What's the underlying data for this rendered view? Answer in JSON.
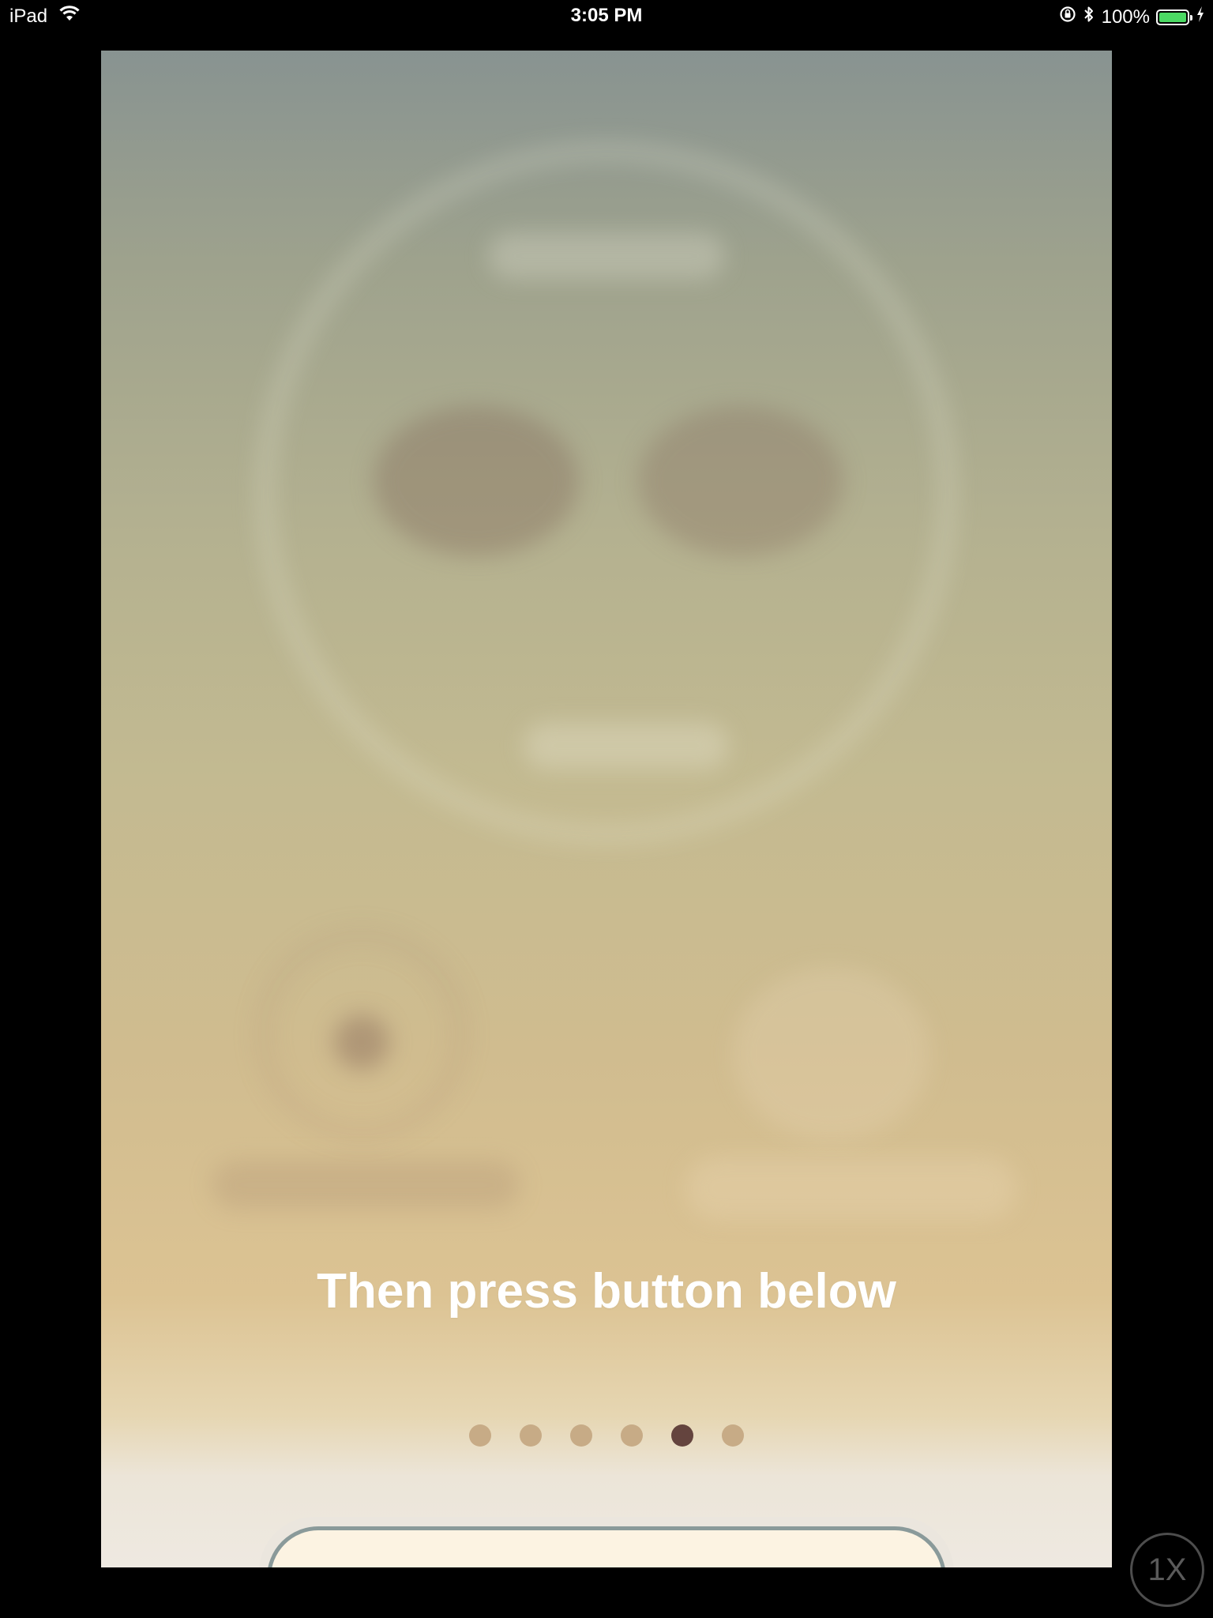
{
  "status_bar": {
    "device": "iPad",
    "time": "3:05 PM",
    "battery_percent": "100%",
    "battery_level": 1.0,
    "battery_color": "#4cd964",
    "icons": [
      "wifi-icon",
      "orientation-lock-icon",
      "bluetooth-icon",
      "battery-icon",
      "charging-bolt-icon"
    ]
  },
  "onboarding": {
    "caption": "Then press button below",
    "page_count": 6,
    "current_page": 5,
    "dot_color": "#c7ab86",
    "active_dot_color": "#64443e"
  },
  "zoom": {
    "label": "1X"
  }
}
